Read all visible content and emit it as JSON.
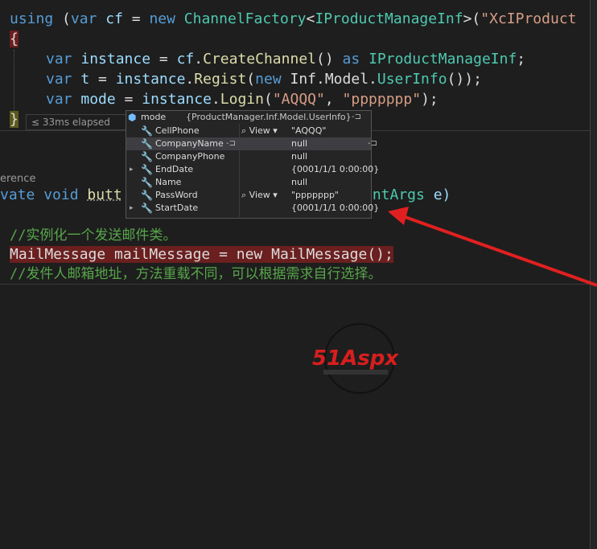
{
  "editor": {
    "line1": {
      "kw_using": "using",
      "p1": " (",
      "kw_var": "var",
      "sp": " ",
      "id_cf": "cf",
      "eq": " = ",
      "kw_new": "new",
      "ty_factory": "ChannelFactory",
      "lt": "<",
      "ty_inf": "IProductManageInf",
      "gt": ">(",
      "st": "\"XcIProduct"
    },
    "line2": {
      "brace": "{"
    },
    "line3": {
      "kw_var": "var",
      "id_instance": "instance",
      "eq": " = ",
      "id_cf": "cf",
      "dot": ".",
      "fn_create": "CreateChannel",
      "paren": "()",
      "kw_as": "as",
      "ty_inf": "IProductManageInf",
      "semi": ";"
    },
    "line4": {
      "kw_var": "var",
      "id_t": "t",
      "eq": " = ",
      "id_instance": "instance",
      "dot": ".",
      "fn_regist": "Regist",
      "p": "(",
      "kw_new": "new",
      "ns": "Inf.Model.",
      "ty_user": "UserInfo",
      "end": "());"
    },
    "line5": {
      "kw_var": "var",
      "id_mode": "mode",
      "eq": " = ",
      "id_instance": "instance",
      "dot": ".",
      "fn_login": "Login",
      "p": "(",
      "st1": "\"AQQQ\"",
      "comma": ", ",
      "st2": "\"ppppppp\"",
      "end": ");"
    },
    "line6": {
      "brace": "}"
    },
    "elapsed": "≤ 33ms elapsed",
    "refs": "erence",
    "line_method": {
      "kw_private": "vate",
      "kw_void": "void",
      "fn_butt": "butt",
      "ty_args": "entArgs",
      "id_e": "e)"
    },
    "comment1": "//实例化一个发送邮件类。",
    "mail_line": "MailMessage mailMessage = new MailMessage();",
    "comment2": "//发件人邮箱地址，方法重载不同，可以根据需求自行选择。"
  },
  "datatip": {
    "header_name": "mode",
    "header_value": "{ProductManager.Inf.Model.UserInfo}",
    "view_label": "View",
    "rows": [
      {
        "name": "CellPhone",
        "value": "\"AQQQ\"",
        "has_view": true,
        "expandable": false
      },
      {
        "name": "CompanyName",
        "value": "null",
        "has_view": false,
        "expandable": false
      },
      {
        "name": "CompanyPhone",
        "value": "null",
        "has_view": false,
        "expandable": false
      },
      {
        "name": "EndDate",
        "value": "{0001/1/1 0:00:00}",
        "has_view": false,
        "expandable": true
      },
      {
        "name": "Name",
        "value": "null",
        "has_view": false,
        "expandable": false
      },
      {
        "name": "PassWord",
        "value": "\"ppppppp\"",
        "has_view": true,
        "expandable": false
      },
      {
        "name": "StartDate",
        "value": "{0001/1/1 0:00:00}",
        "has_view": false,
        "expandable": true
      }
    ]
  },
  "watermark": {
    "brand": "51Aspx"
  },
  "colors": {
    "background": "#1e1e1e",
    "keyword": "#569cd6",
    "type": "#4ec9b0",
    "string": "#d69d85",
    "comment": "#57a64a",
    "highlight": "#6b1f1f",
    "arrow": "#e02020"
  },
  "icons": {
    "object": "cube-icon",
    "property": "wrench-icon",
    "search": "magnifier-icon",
    "pin": "pin-icon",
    "arrow": "red-arrow"
  }
}
